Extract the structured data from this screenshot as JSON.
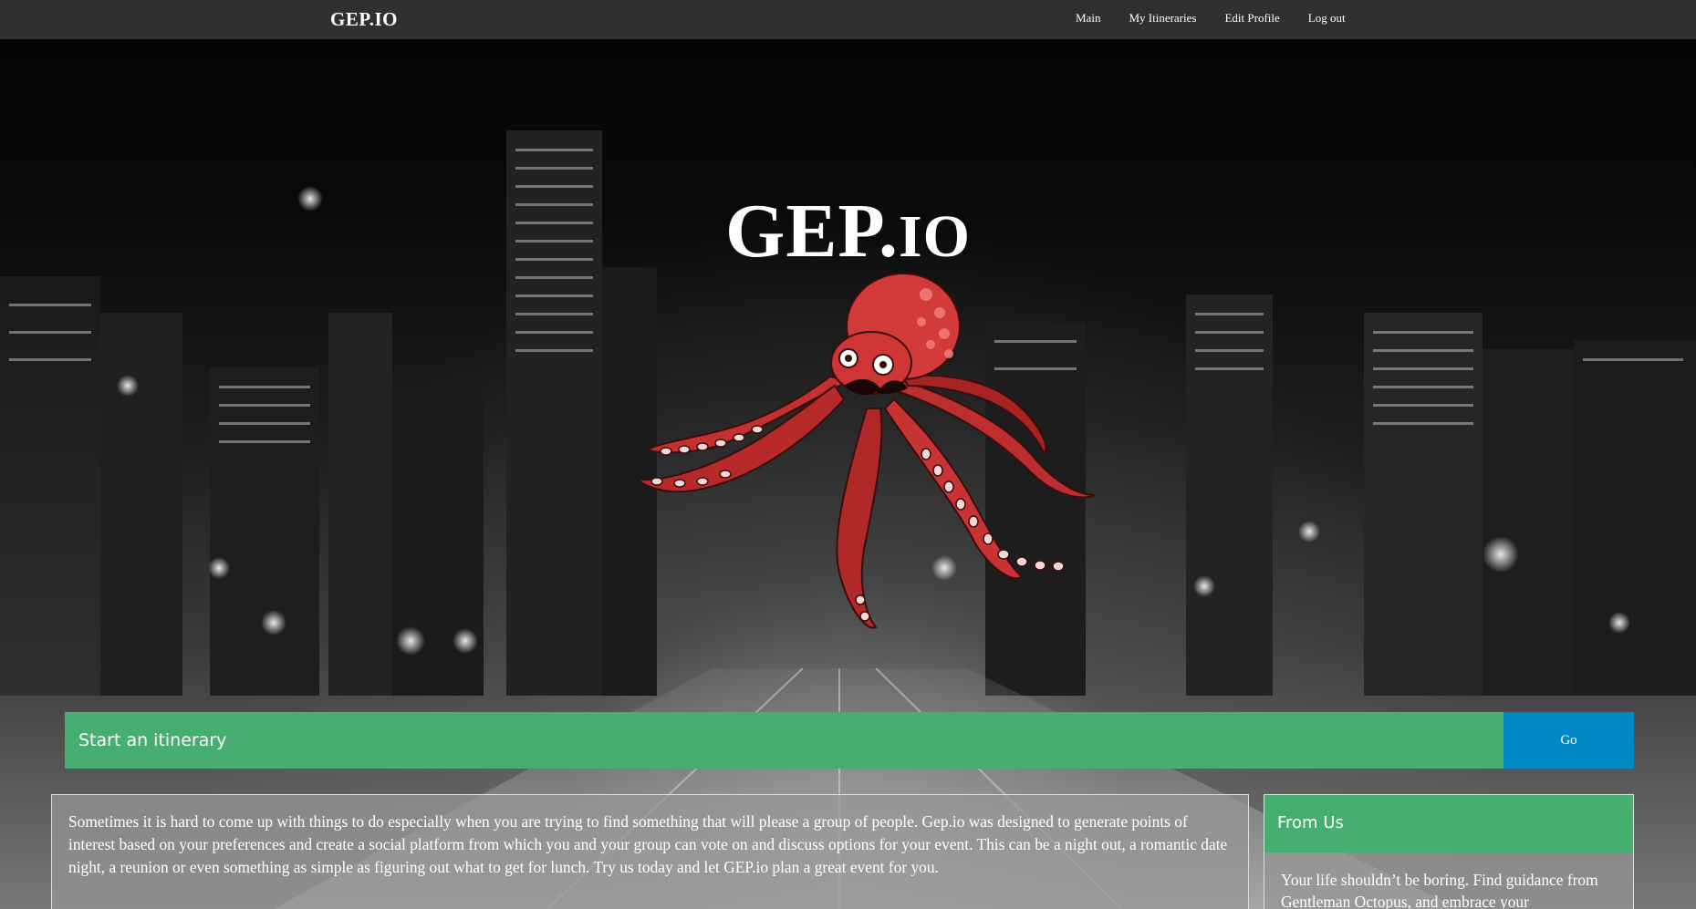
{
  "navbar": {
    "brand": "GEP.IO",
    "links": [
      "Main",
      "My Itineraries",
      "Edit Profile",
      "Log out"
    ]
  },
  "hero": {
    "logo_main": "GEP.",
    "logo_small": "IO",
    "logo_icon": "octopus-icon"
  },
  "search": {
    "placeholder": "Start an itinerary",
    "value": "",
    "button_label": "Go"
  },
  "about": {
    "text": "Sometimes it is hard to come up with things to do especially when you are trying to find something that will please a group of people. Gep.io was designed to generate points of interest based on your preferences and create a social platform from which you and your group can vote on and discuss options for your event. This can be a night out, a romantic date night, a reunion or even something as simple as figuring out what to get for lunch. Try us today and let GEP.io plan a great event for you."
  },
  "from_us": {
    "heading": "From Us",
    "body": "Your life shouldn’t be boring. Find guidance from Gentleman Octopus, and embrace your"
  },
  "colors": {
    "navbar": "#303030",
    "accent_green": "#46ae6e",
    "accent_blue": "#0089c4",
    "octopus_red": "#d33a3a"
  }
}
